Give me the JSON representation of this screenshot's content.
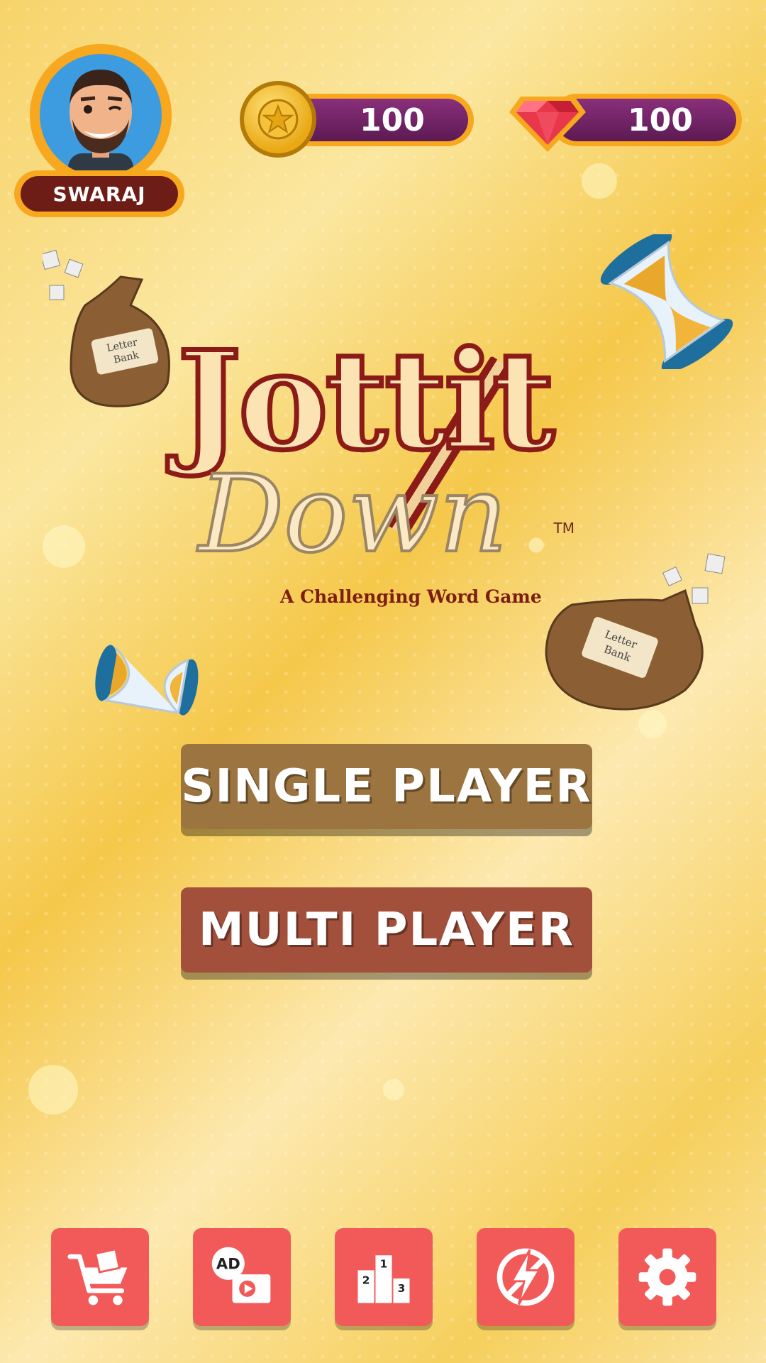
{
  "player": {
    "name": "SWARAJ"
  },
  "currency": {
    "coins": "100",
    "gems": "100"
  },
  "logo": {
    "title": "Jottit",
    "subtitle": "Down",
    "trademark": "TM",
    "tagline": "A Challenging Word Game",
    "bag_label": "Letter Bank"
  },
  "menu": {
    "single_player": "SINGLE PLAYER",
    "multi_player": "MULTI PLAYER"
  },
  "toolbar": {
    "items": [
      {
        "name": "shop",
        "icon": "cart-icon"
      },
      {
        "name": "watch-ad",
        "icon": "ad-video-icon",
        "label": "AD"
      },
      {
        "name": "leaderboard",
        "icon": "podium-icon",
        "ranks": [
          "1",
          "2",
          "3"
        ]
      },
      {
        "name": "no-ads",
        "icon": "lightning-icon"
      },
      {
        "name": "settings",
        "icon": "gear-icon"
      }
    ]
  },
  "colors": {
    "accent_orange": "#f7a81f",
    "currency_purple": "#7a2a6e",
    "single_button": "#9c7440",
    "multi_button": "#a24f3b",
    "toolbar_button": "#f25a5a",
    "logo_red": "#8c1b17"
  }
}
